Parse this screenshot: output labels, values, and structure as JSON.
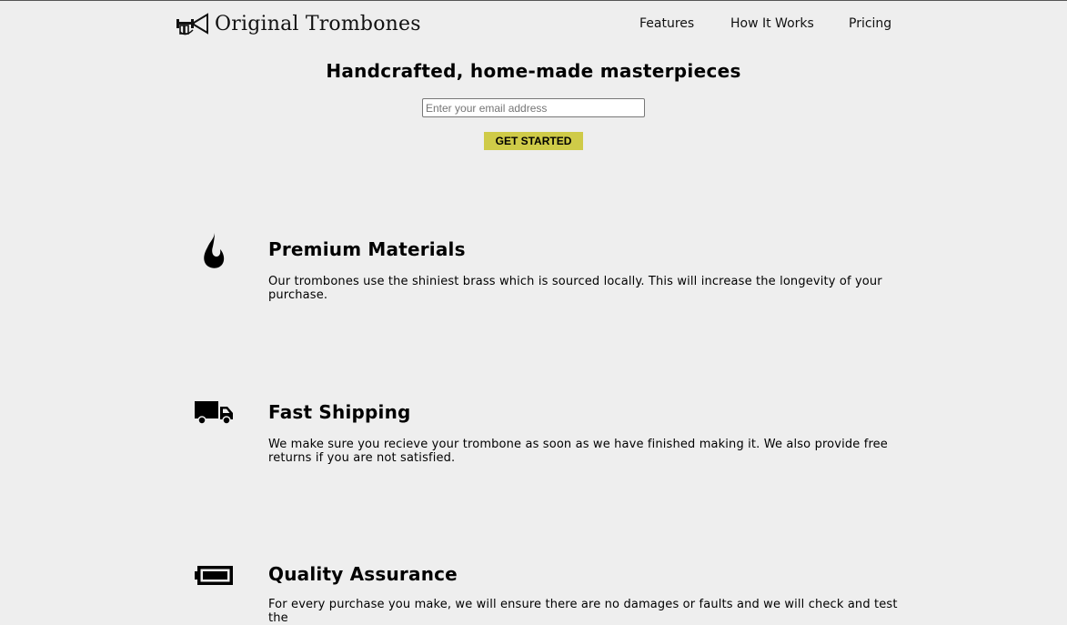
{
  "header": {
    "brand": "Original Trombones",
    "logo_icon": "trombone-icon",
    "nav": [
      {
        "label": "Features"
      },
      {
        "label": "How It Works"
      },
      {
        "label": "Pricing"
      }
    ]
  },
  "hero": {
    "title": "Handcrafted, home-made masterpieces",
    "email_placeholder": "Enter your email address",
    "cta_label": "GET STARTED",
    "cta_color": "#cfcb48"
  },
  "features": [
    {
      "icon": "flame-icon",
      "title": "Premium Materials",
      "description": "Our trombones use the shiniest brass which is sourced locally. This will increase the longevity of your purchase."
    },
    {
      "icon": "truck-icon",
      "title": "Fast Shipping",
      "description": "We make sure you recieve your trombone as soon as we have finished making it. We also provide free returns if you are not satisfied."
    },
    {
      "icon": "battery-full-icon",
      "title": "Quality Assurance",
      "description": "For every purchase you make, we will ensure there are no damages or faults and we will check and test the"
    }
  ]
}
